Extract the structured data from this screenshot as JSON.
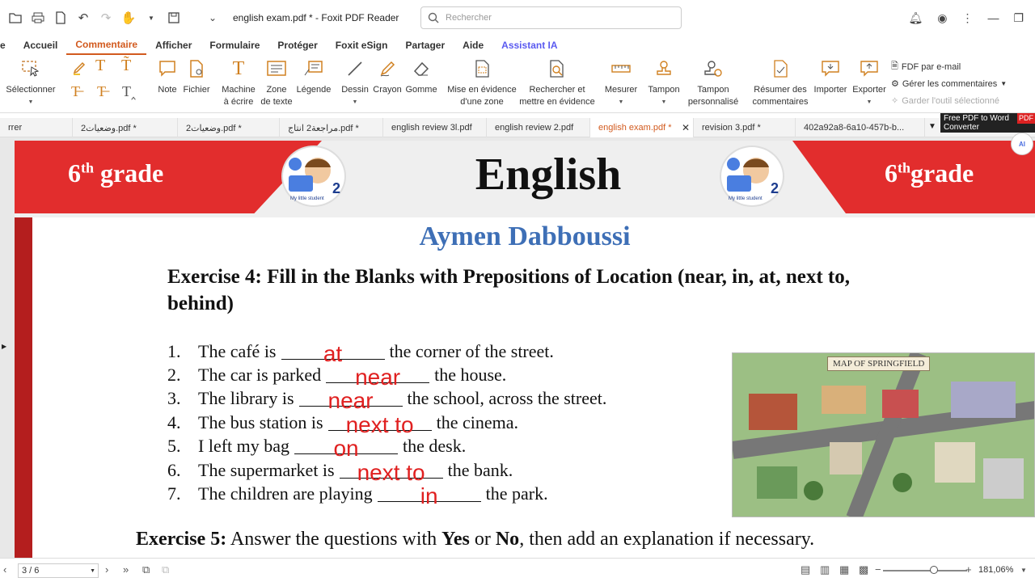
{
  "window": {
    "title": "english exam.pdf * - Foxit PDF Reader",
    "search_placeholder": "Rechercher"
  },
  "menu": {
    "tabs": [
      "Accueil",
      "Commentaire",
      "Afficher",
      "Formulaire",
      "Protéger",
      "Foxit eSign",
      "Partager",
      "Aide",
      "Assistant IA"
    ],
    "active": "Commentaire"
  },
  "ribbon": {
    "select": "Sélectionner",
    "note": "Note",
    "file": "Fichier",
    "typewriter_1": "Machine",
    "typewriter_2": "à écrire",
    "textbox_1": "Zone",
    "textbox_2": "de texte",
    "callout": "Légende",
    "drawing": "Dessin",
    "pencil": "Crayon",
    "eraser": "Gomme",
    "area_highlight_1": "Mise en évidence",
    "area_highlight_2": "d'une zone",
    "search_highlight_1": "Rechercher et",
    "search_highlight_2": "mettre en évidence",
    "measure": "Mesurer",
    "stamp": "Tampon",
    "custom_stamp_1": "Tampon",
    "custom_stamp_2": "personnalisé",
    "summarize_1": "Résumer des",
    "summarize_2": "commentaires",
    "import": "Importer",
    "export": "Exporter",
    "fdf_email": "FDF par e-mail",
    "manage_comments": "Gérer les commentaires",
    "keep_tool": "Garder l'outil sélectionné"
  },
  "doc_tabs": [
    "rrer",
    "وضعيات2.pdf *",
    "وضعيات2.pdf *",
    "مراجعة2 انتاج.pdf *",
    "english review 3l.pdf",
    "english review 2.pdf",
    "english exam.pdf *",
    "revision 3.pdf *",
    "402a92a8-6a10-457b-b..."
  ],
  "promo": {
    "line1": "Free PDF to Word",
    "line2": "Converter",
    "badge": "PDF"
  },
  "ai_badge": "AI",
  "document": {
    "grade_left_num": "6",
    "grade_left_sup": "th",
    "grade_left_word": " grade",
    "grade_right_num": "6",
    "grade_right_sup": "th",
    "grade_right_word": "grade",
    "title": "English",
    "author": "Aymen Dabboussi",
    "logo_caption": "My little student",
    "exercise4_heading": "Exercise 4: Fill in the Blanks with Prepositions of Location (near, in, at, next to, behind)",
    "items": [
      {
        "num": "1.",
        "before": "The café is",
        "answer": "at",
        "after": "the corner of the street."
      },
      {
        "num": "2.",
        "before": "The car is parked",
        "answer": "near",
        "after": "the house."
      },
      {
        "num": "3.",
        "before": "The library is",
        "answer": "near",
        "after": "the school, across the street."
      },
      {
        "num": "4.",
        "before": "The bus station is",
        "answer": "next to",
        "after": "the cinema."
      },
      {
        "num": "5.",
        "before": "I left my bag",
        "answer": "on",
        "after": "the desk."
      },
      {
        "num": "6.",
        "before": "The supermarket is",
        "answer": "next to",
        "after": "the bank."
      },
      {
        "num": "7.",
        "before": "The children are playing",
        "answer": "in",
        "after": "the park."
      }
    ],
    "map_title": "MAP OF SPRINGFIELD",
    "exercise5_label": "Exercise 5:",
    "exercise5_text_a": " Answer the questions with ",
    "exercise5_yes": "Yes",
    "exercise5_or": " or ",
    "exercise5_no": "No",
    "exercise5_text_b": ", then add an explanation if necessary."
  },
  "status": {
    "page": "3 / 6",
    "zoom": "181,06%"
  },
  "colors": {
    "accent": "#d25a1e",
    "banner_red": "#e22d2d",
    "author_blue": "#3e6fb6",
    "answer_red": "#e02020"
  }
}
